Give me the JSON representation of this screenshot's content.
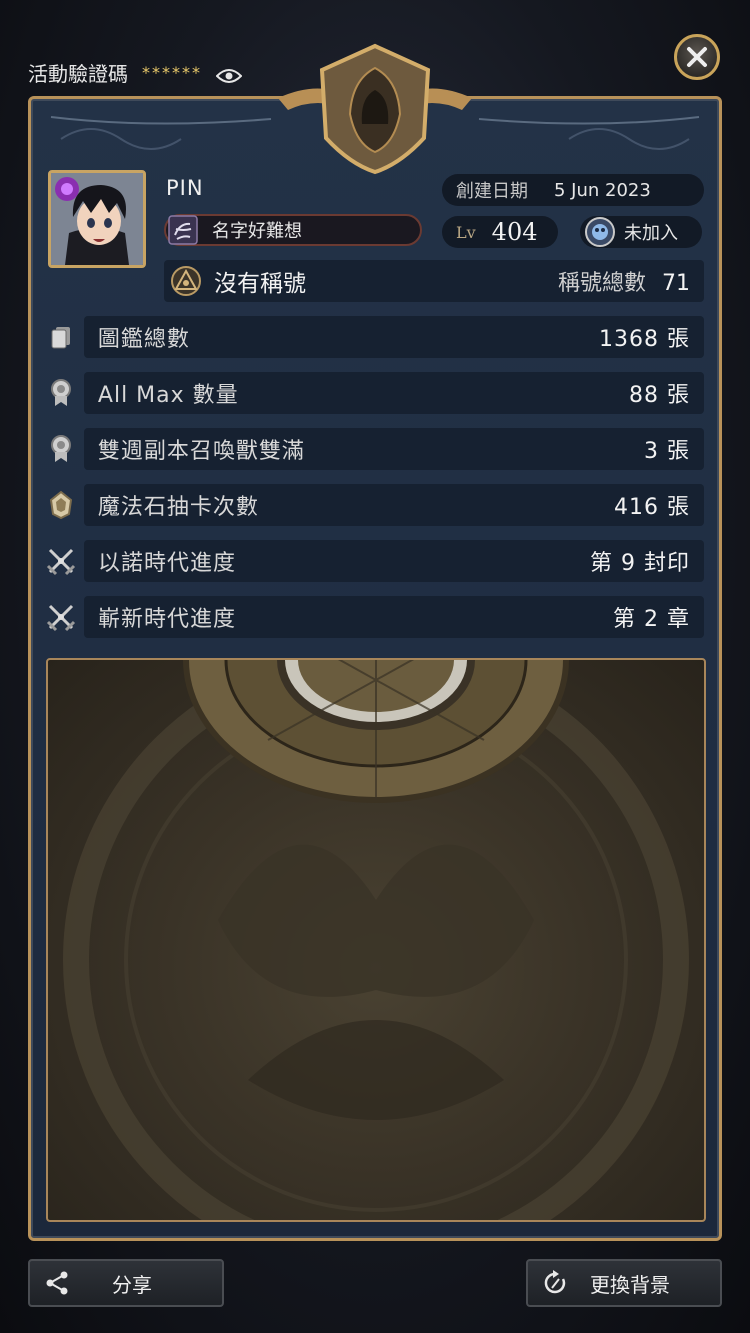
{
  "top": {
    "code_label": "活動驗證碼",
    "code_value": "******"
  },
  "profile": {
    "name": "PIN",
    "guild_name": "名字好難想",
    "create_label": "創建日期",
    "create_date": "5 Jun 2023",
    "lv_label": "Lv",
    "level": "404",
    "join_status": "未加入"
  },
  "title_bar": {
    "title": "沒有稱號",
    "count_label": "稱號總數",
    "count_value": "71"
  },
  "stats": [
    {
      "label": "圖鑑總數",
      "value": "1368 張",
      "icon": "card-stack-icon"
    },
    {
      "label": "All Max 數量",
      "value": "88 張",
      "icon": "medal-icon"
    },
    {
      "label": "雙週副本召喚獸雙滿",
      "value": "3 張",
      "icon": "medal-icon"
    },
    {
      "label": "魔法石抽卡次數",
      "value": "416 張",
      "icon": "gem-icon"
    },
    {
      "label": "以諾時代進度",
      "value": "第 9 封印",
      "icon": "crossed-swords-icon"
    },
    {
      "label": "嶄新時代進度",
      "value": "第 2 章",
      "icon": "crossed-swords-icon"
    }
  ],
  "buttons": {
    "share": "分享",
    "change_bg": "更換背景"
  },
  "colors": {
    "gold": "#c9a45a",
    "panel": "#213045",
    "bar": "#162131"
  }
}
